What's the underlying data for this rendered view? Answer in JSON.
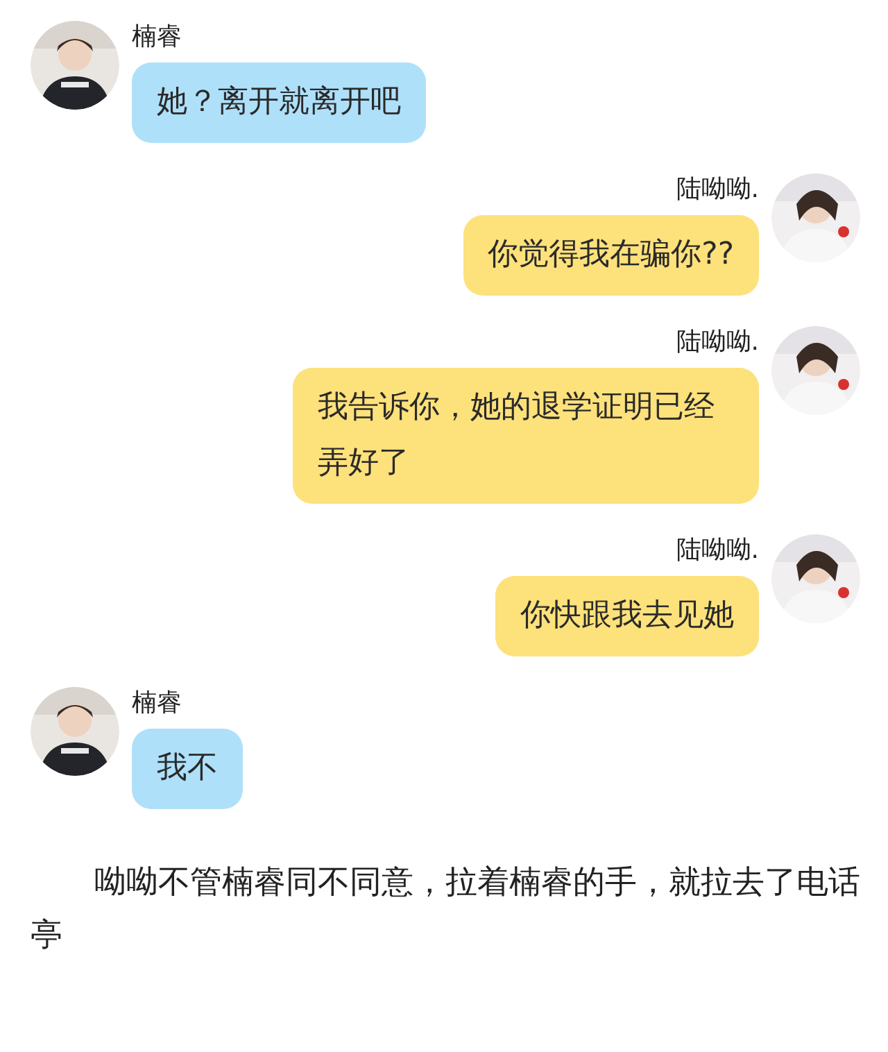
{
  "messages": [
    {
      "kind": "incoming",
      "name": "楠睿",
      "text": "她？离开就离开吧"
    },
    {
      "kind": "outgoing",
      "name": "陆呦呦.",
      "text": "你觉得我在骗你??"
    },
    {
      "kind": "outgoing",
      "name": "陆呦呦.",
      "text": "我告诉你，她的退学证明已经弄好了"
    },
    {
      "kind": "outgoing",
      "name": "陆呦呦.",
      "text": "你快跟我去见她"
    },
    {
      "kind": "incoming",
      "name": "楠睿",
      "text": "我不"
    }
  ],
  "narration": "呦呦不管楠睿同不同意，拉着楠睿的手，就拉去了电话亭"
}
